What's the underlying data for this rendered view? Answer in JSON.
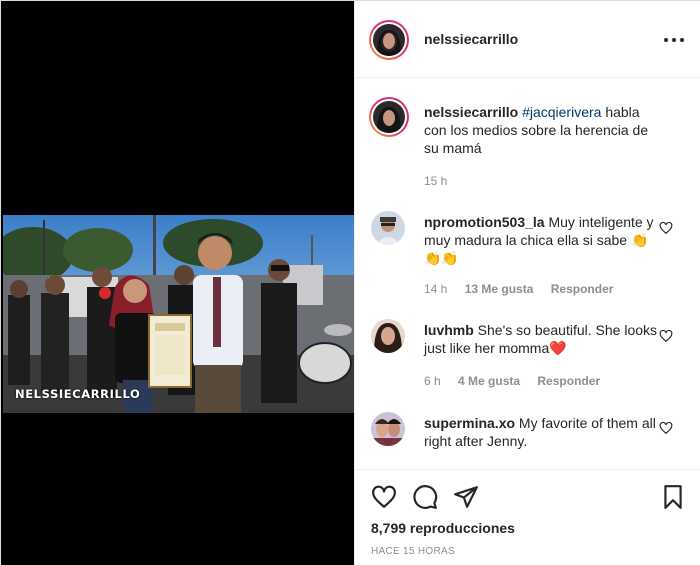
{
  "post": {
    "watermark": "NELSSIECARRILLO",
    "author": "nelssiecarrillo"
  },
  "caption": {
    "username": "nelssiecarrillo",
    "tag": "#jacqierivera",
    "text": "habla con los medios sobre la herencia de su mamá",
    "age": "15 h"
  },
  "comments": [
    {
      "username": "npromotion503_la",
      "text": "Muy inteligente y muy madura la chica ella si sabe 👏👏👏",
      "age": "14 h",
      "likes": "13 Me gusta",
      "reply": "Responder"
    },
    {
      "username": "luvhmb",
      "text": "She's so beautiful. She looks just like her momma❤️",
      "age": "6 h",
      "likes": "4 Me gusta",
      "reply": "Responder"
    },
    {
      "username": "supermina.xo",
      "text": "My favorite of them all right after Jenny."
    }
  ],
  "actions": {
    "views": "8,799 reproducciones",
    "timestamp": "HACE 15 HORAS"
  },
  "icons": {
    "like": "heart-icon",
    "comment": "comment-icon",
    "share": "share-icon",
    "save": "bookmark-icon",
    "more": "more-options-icon"
  },
  "colors": {
    "story_ring": "#e1306c",
    "hashtag": "#00376b",
    "muted": "#8e8e8e",
    "heart": "#ed4956"
  }
}
